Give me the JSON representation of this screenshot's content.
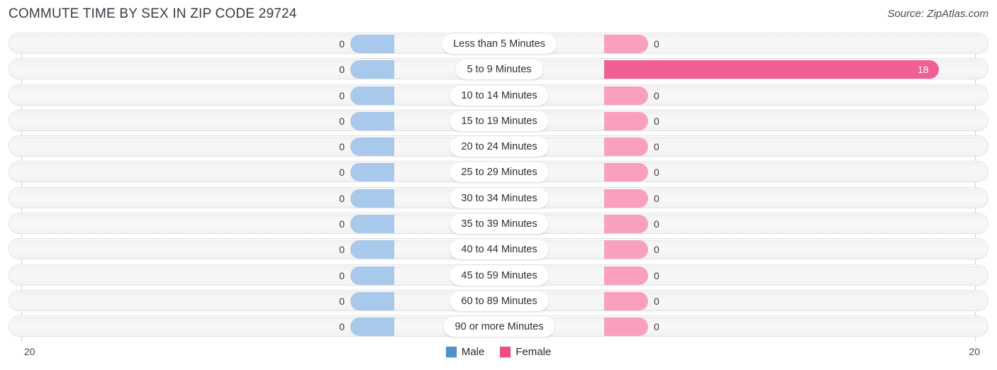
{
  "header": {
    "title": "COMMUTE TIME BY SEX IN ZIP CODE 29724",
    "source": "Source: ZipAtlas.com"
  },
  "legend": {
    "male_label": "Male",
    "female_label": "Female",
    "male_color": "#4f90cd",
    "female_color": "#ee4c85"
  },
  "axis": {
    "left_tick": "20",
    "right_tick": "20",
    "max": 20
  },
  "chart_data": {
    "type": "bar",
    "orientation": "horizontal-diverging",
    "title": "COMMUTE TIME BY SEX IN ZIP CODE 29724",
    "xlabel": "",
    "ylabel": "",
    "xlim": [
      20,
      20
    ],
    "grid": false,
    "legend_position": "bottom-center",
    "categories": [
      "Less than 5 Minutes",
      "5 to 9 Minutes",
      "10 to 14 Minutes",
      "15 to 19 Minutes",
      "20 to 24 Minutes",
      "25 to 29 Minutes",
      "30 to 34 Minutes",
      "35 to 39 Minutes",
      "40 to 44 Minutes",
      "45 to 59 Minutes",
      "60 to 89 Minutes",
      "90 or more Minutes"
    ],
    "series": [
      {
        "name": "Male",
        "values": [
          0,
          0,
          0,
          0,
          0,
          0,
          0,
          0,
          0,
          0,
          0,
          0
        ]
      },
      {
        "name": "Female",
        "values": [
          0,
          18,
          0,
          0,
          0,
          0,
          0,
          0,
          0,
          0,
          0,
          0
        ]
      }
    ]
  },
  "rows": [
    {
      "label": "Less than 5 Minutes",
      "male": "0",
      "female": "0",
      "male_val": 0,
      "female_val": 0
    },
    {
      "label": "5 to 9 Minutes",
      "male": "0",
      "female": "18",
      "male_val": 0,
      "female_val": 18
    },
    {
      "label": "10 to 14 Minutes",
      "male": "0",
      "female": "0",
      "male_val": 0,
      "female_val": 0
    },
    {
      "label": "15 to 19 Minutes",
      "male": "0",
      "female": "0",
      "male_val": 0,
      "female_val": 0
    },
    {
      "label": "20 to 24 Minutes",
      "male": "0",
      "female": "0",
      "male_val": 0,
      "female_val": 0
    },
    {
      "label": "25 to 29 Minutes",
      "male": "0",
      "female": "0",
      "male_val": 0,
      "female_val": 0
    },
    {
      "label": "30 to 34 Minutes",
      "male": "0",
      "female": "0",
      "male_val": 0,
      "female_val": 0
    },
    {
      "label": "35 to 39 Minutes",
      "male": "0",
      "female": "0",
      "male_val": 0,
      "female_val": 0
    },
    {
      "label": "40 to 44 Minutes",
      "male": "0",
      "female": "0",
      "male_val": 0,
      "female_val": 0
    },
    {
      "label": "45 to 59 Minutes",
      "male": "0",
      "female": "0",
      "male_val": 0,
      "female_val": 0
    },
    {
      "label": "60 to 89 Minutes",
      "male": "0",
      "female": "0",
      "male_val": 0,
      "female_val": 0
    },
    {
      "label": "90 or more Minutes",
      "male": "0",
      "female": "0",
      "male_val": 0,
      "female_val": 0
    }
  ]
}
